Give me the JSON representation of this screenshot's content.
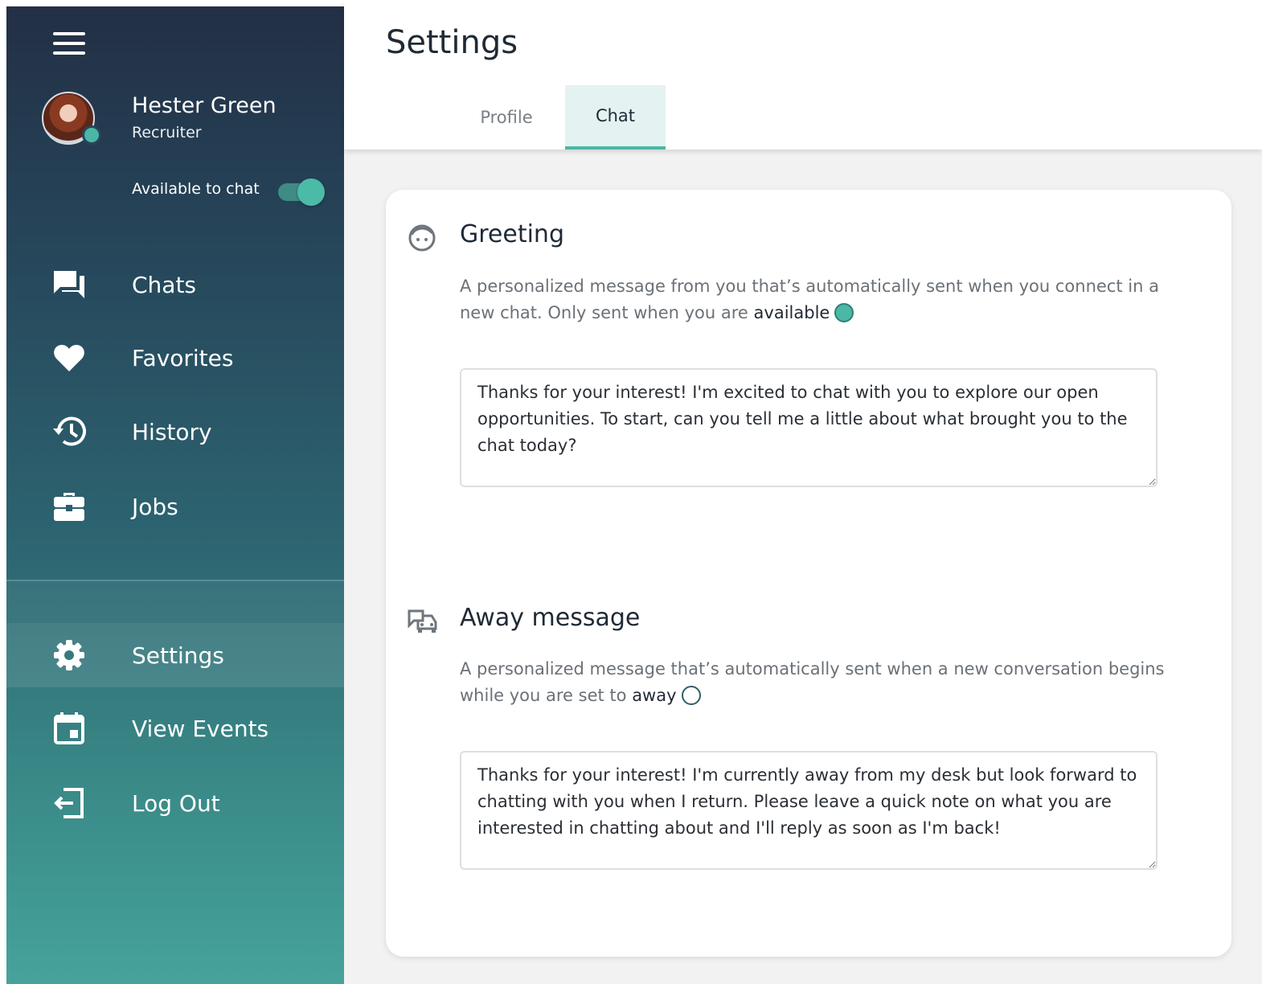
{
  "sidebar": {
    "user": {
      "name": "Hester Green",
      "role": "Recruiter"
    },
    "availability": {
      "label": "Available to chat",
      "on": true
    },
    "nav": [
      {
        "label": "Chats",
        "icon": "chat-bubbles-icon"
      },
      {
        "label": "Favorites",
        "icon": "heart-icon"
      },
      {
        "label": "History",
        "icon": "history-icon"
      },
      {
        "label": "Jobs",
        "icon": "briefcase-icon"
      }
    ],
    "nav_bottom": [
      {
        "label": "Settings",
        "icon": "gear-icon",
        "active": true
      },
      {
        "label": "View Events",
        "icon": "calendar-icon"
      },
      {
        "label": "Log Out",
        "icon": "logout-icon"
      }
    ]
  },
  "header": {
    "title": "Settings",
    "tabs": [
      {
        "label": "Profile",
        "active": false
      },
      {
        "label": "Chat",
        "active": true
      }
    ]
  },
  "greeting": {
    "title": "Greeting",
    "desc_prefix": "A personalized message from you that’s automatically sent when you connect in a new chat. Only sent when you are",
    "status_word": "available",
    "message": "Thanks for your interest! I'm excited to chat with you to explore our open opportunities. To start, can you tell me a little about what brought you to the chat today?"
  },
  "away": {
    "title": "Away message",
    "desc_prefix": "A personalized message that’s automatically sent when a new conversation begins while you are set to",
    "status_word": "away",
    "message": "Thanks for your interest! I'm currently away from my desk but look forward to chatting with you when I return. Please leave a quick note on what you are interested in chatting about and I'll reply as soon as I'm back!"
  },
  "colors": {
    "accent": "#4bb7a5",
    "sidebar_top": "#232f45",
    "sidebar_bottom": "#46a39b",
    "active_tab_bg": "#e4f2f1"
  }
}
